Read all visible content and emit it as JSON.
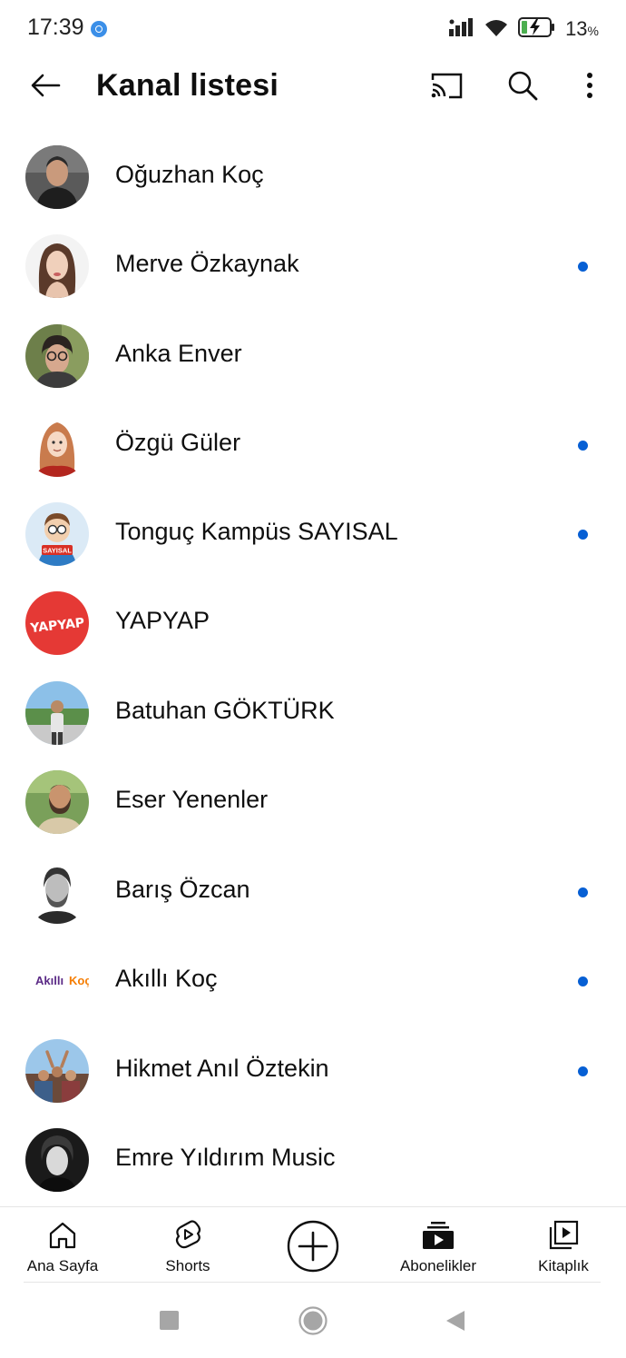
{
  "status_bar": {
    "time": "17:39",
    "battery_percent": "13",
    "battery_unit": "%",
    "icons": [
      "notification-badge-icon",
      "signal-icon",
      "wifi-icon",
      "battery-charging-icon"
    ]
  },
  "app_bar": {
    "title": "Kanal listesi",
    "icons": [
      "back-arrow-icon",
      "cast-icon",
      "search-icon",
      "more-vert-icon"
    ]
  },
  "channels": [
    {
      "name": "Oğuzhan Koç",
      "new_content": false
    },
    {
      "name": "Merve Özkaynak",
      "new_content": true
    },
    {
      "name": "Anka Enver",
      "new_content": false
    },
    {
      "name": "Özgü Güler",
      "new_content": true
    },
    {
      "name": "Tonguç Kampüs SAYISAL",
      "new_content": true
    },
    {
      "name": "YAPYAP",
      "new_content": false
    },
    {
      "name": "Batuhan GÖKTÜRK",
      "new_content": false
    },
    {
      "name": "Eser Yenenler",
      "new_content": false
    },
    {
      "name": "Barış Özcan",
      "new_content": true
    },
    {
      "name": "Akıllı Koç",
      "new_content": true
    },
    {
      "name": "Hikmet Anıl Öztekin",
      "new_content": true
    },
    {
      "name": "Emre Yıldırım Music",
      "new_content": false
    }
  ],
  "avatar_logos": {
    "tonguc": "SAYISAL",
    "yapyap": "YAPYAP",
    "akilli_koc_part1": "Akıllı",
    "akilli_koc_part2": "Koç"
  },
  "bottom_nav": {
    "items": [
      {
        "label": "Ana Sayfa",
        "icon": "home-icon"
      },
      {
        "label": "Shorts",
        "icon": "shorts-icon"
      },
      {
        "label": "",
        "icon": "create-plus-icon"
      },
      {
        "label": "Abonelikler",
        "icon": "subscriptions-icon"
      },
      {
        "label": "Kitaplık",
        "icon": "library-icon"
      }
    ]
  },
  "colors": {
    "new_content_dot": "#065fd4",
    "text_primary": "#0f0f0f",
    "yapyap_red": "#e53935"
  }
}
